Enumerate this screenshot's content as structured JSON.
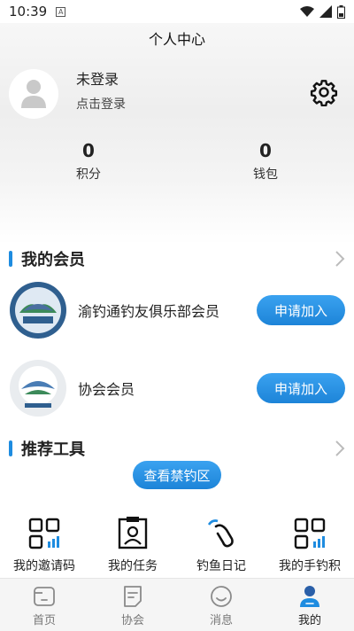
{
  "status_bar": {
    "time": "10:39",
    "badge": "A"
  },
  "header": {
    "title": "个人中心"
  },
  "profile": {
    "name": "未登录",
    "action": "点击登录"
  },
  "stats": [
    {
      "value": "0",
      "label": "积分"
    },
    {
      "value": "0",
      "label": "钱包"
    }
  ],
  "membership": {
    "title": "我的会员",
    "items": [
      {
        "name": "渝钓通钓友俱乐部会员",
        "button": "申请加入"
      },
      {
        "name": "协会会员",
        "button": "申请加入"
      }
    ]
  },
  "tools": {
    "title": "推荐工具",
    "banned_zone_button": "查看禁钓区",
    "items": [
      {
        "label": "我的邀请码",
        "icon": "grid-chart-icon"
      },
      {
        "label": "我的任务",
        "icon": "portrait-frame-icon"
      },
      {
        "label": "钓鱼日记",
        "icon": "fishing-hook-icon"
      },
      {
        "label": "我的手钓积",
        "icon": "grid-chart-icon"
      }
    ]
  },
  "tabbar": {
    "items": [
      {
        "label": "首页",
        "icon": "home-icon"
      },
      {
        "label": "协会",
        "icon": "document-icon"
      },
      {
        "label": "消息",
        "icon": "smile-icon"
      },
      {
        "label": "我的",
        "icon": "person-icon"
      }
    ],
    "active": "我的"
  },
  "colors": {
    "accent": "#1e8ce0"
  }
}
